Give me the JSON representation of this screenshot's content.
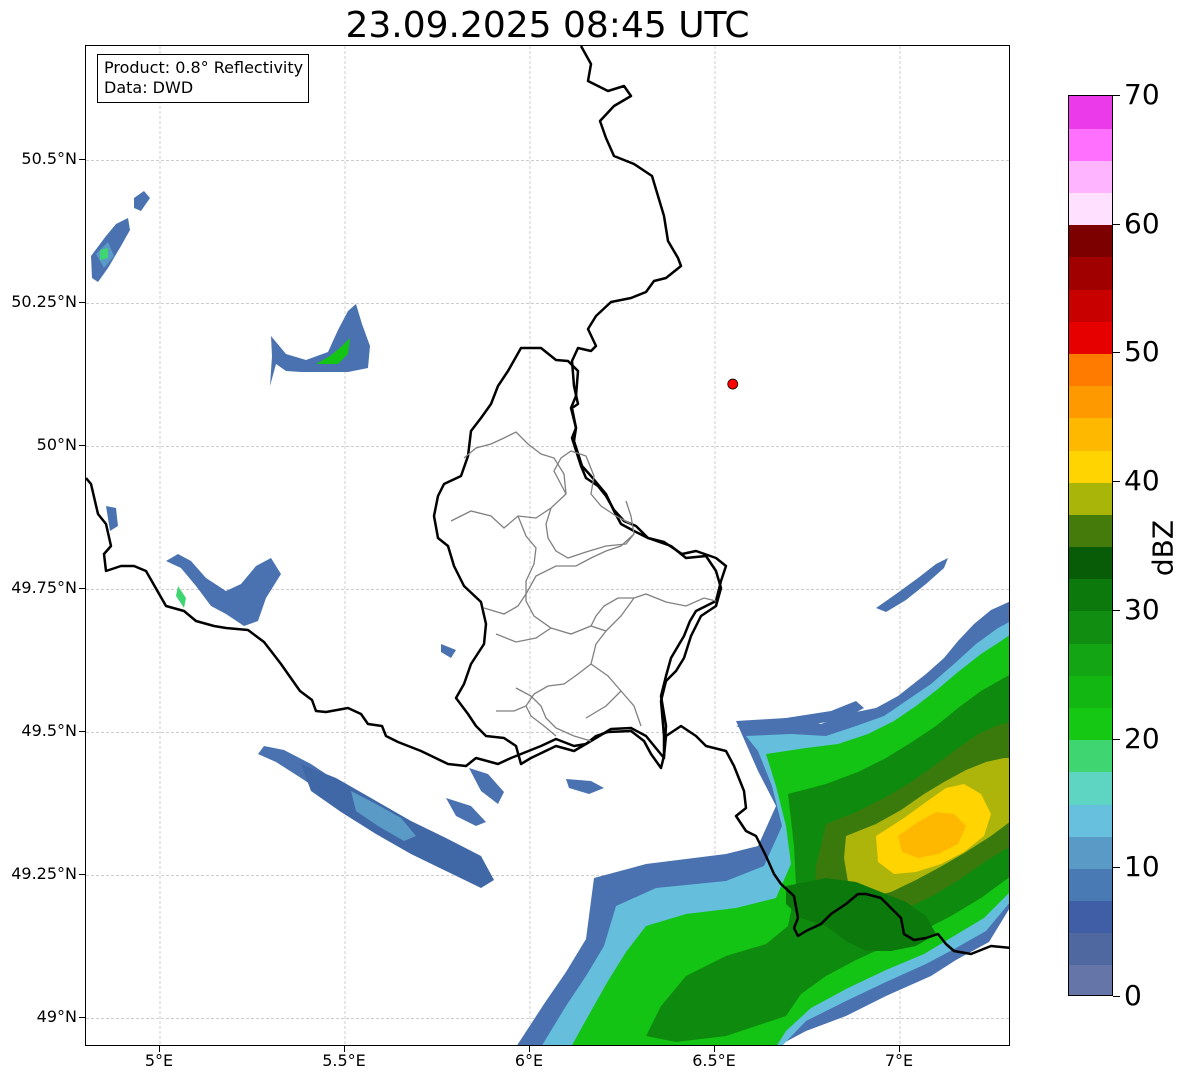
{
  "title": "23.09.2025 08:45 UTC",
  "info": {
    "product": "Product: 0.8° Reflectivity",
    "data_source": "Data: DWD"
  },
  "map": {
    "lon_range": [
      4.8,
      7.3
    ],
    "lat_range": [
      48.95,
      50.7
    ],
    "x_ticks": [
      "5°E",
      "5.5°E",
      "6°E",
      "6.5°E",
      "7°E"
    ],
    "x_tick_values": [
      5.0,
      5.5,
      6.0,
      6.5,
      7.0
    ],
    "y_ticks": [
      "50.5°N",
      "50.25°N",
      "50°N",
      "49.75°N",
      "49.5°N",
      "49.25°N",
      "49°N"
    ],
    "y_tick_values": [
      50.5,
      50.25,
      50.0,
      49.75,
      49.5,
      49.25,
      49.0
    ],
    "gridlines": true,
    "radar_site": {
      "lon": 6.548,
      "lat": 50.109,
      "color": "#ff0000"
    },
    "border_color": "#000000",
    "district_color": "#808080"
  },
  "colorbar": {
    "label": "dBZ",
    "min": 0,
    "max": 70,
    "ticks": [
      "0",
      "10",
      "20",
      "30",
      "40",
      "50",
      "60",
      "70"
    ],
    "tick_values": [
      0,
      10,
      20,
      30,
      40,
      50,
      60,
      70
    ],
    "colors": [
      "#6575a8",
      "#5068a0",
      "#3f5ea6",
      "#4a7ab4",
      "#5a9ac6",
      "#67c0dd",
      "#5ed4c3",
      "#3fd672",
      "#14c814",
      "#12b712",
      "#14a514",
      "#118d11",
      "#0c790c",
      "#085c08",
      "#457b0a",
      "#aab50a",
      "#ffd400",
      "#ffb800",
      "#ff9900",
      "#ff7b00",
      "#e60000",
      "#c80000",
      "#a10000",
      "#7d0000",
      "#ffe0ff",
      "#ffb4ff",
      "#ff70ff",
      "#ea3aea"
    ]
  }
}
